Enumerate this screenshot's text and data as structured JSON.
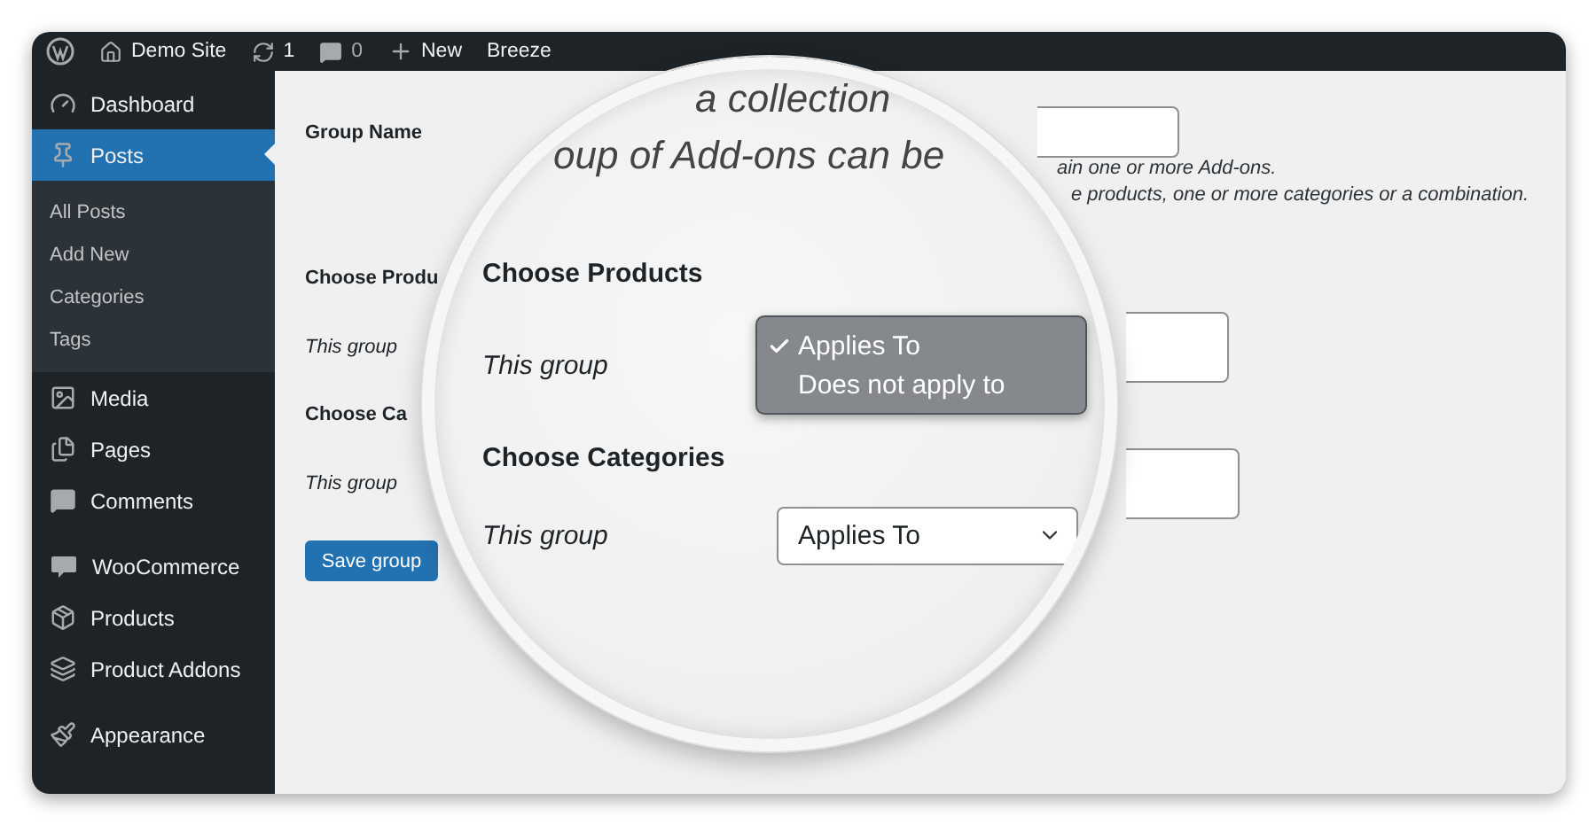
{
  "admin_bar": {
    "site": "Demo Site",
    "updates": "1",
    "comments": "0",
    "new": "New",
    "extra": "Breeze"
  },
  "sidebar": {
    "groups": [
      [
        {
          "label": "Dashboard",
          "kind": "dashboard",
          "selected": false
        },
        {
          "label": "Posts",
          "kind": "pin",
          "selected": true,
          "children": [
            {
              "label": "All Posts"
            },
            {
              "label": "Add New"
            },
            {
              "label": "Categories"
            },
            {
              "label": "Tags"
            }
          ]
        },
        {
          "label": "Media",
          "kind": "media",
          "selected": false
        },
        {
          "label": "Pages",
          "kind": "pages",
          "selected": false
        },
        {
          "label": "Comments",
          "kind": "comment",
          "selected": false
        }
      ],
      [
        {
          "label": "WooCommerce",
          "kind": "woo",
          "selected": false
        },
        {
          "label": "Products",
          "kind": "box",
          "selected": false
        },
        {
          "label": "Product Addons",
          "kind": "layers",
          "selected": false
        }
      ],
      [
        {
          "label": "Appearance",
          "kind": "brush",
          "selected": false
        }
      ]
    ]
  },
  "form": {
    "group_name_label": "Group Name",
    "help": [
      "ain one or more Add-ons.",
      "e products, one or more categories or a combination."
    ],
    "sections": [
      {
        "label": "Choose Produ",
        "row_label": "This group"
      },
      {
        "label": "Choose Ca",
        "row_label": "This group"
      }
    ],
    "save_button": "Save group"
  },
  "magnifier": {
    "top_lines": [
      "a collection",
      "oup of Add-ons can be"
    ],
    "sections": [
      {
        "heading": "Choose Products",
        "row_label": "This group",
        "dropdown": {
          "open": true,
          "options": [
            {
              "label": "Applies To",
              "selected": true
            },
            {
              "label": "Does not apply to",
              "selected": false
            }
          ]
        }
      },
      {
        "heading": "Choose Categories",
        "row_label": "This group",
        "dropdown": {
          "open": false,
          "value": "Applies To"
        }
      }
    ]
  }
}
